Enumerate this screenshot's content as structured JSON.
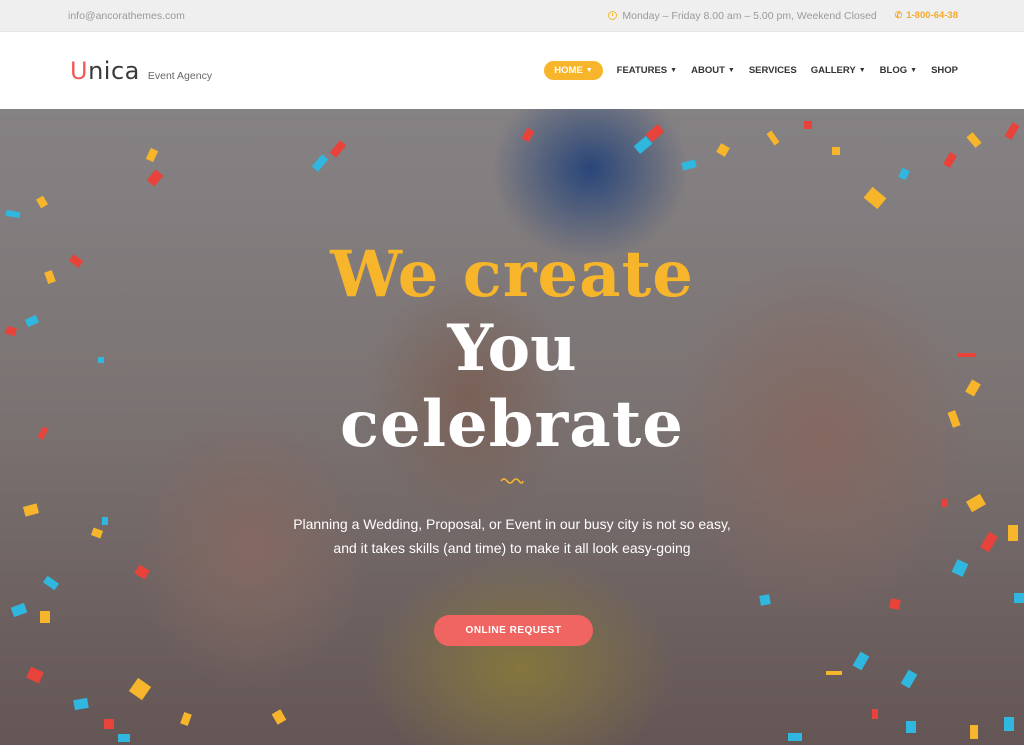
{
  "topbar": {
    "email": "info@ancorathemes.com",
    "hours": "Monday – Friday 8.00 am – 5.00 pm, Weekend Closed",
    "phone": "1-800-64-38"
  },
  "header": {
    "logo_text": "nica",
    "logo_letter": "U",
    "logo_sub": "Event Agency",
    "nav": [
      {
        "label": "HOME",
        "dropdown": true
      },
      {
        "label": "FEATURES",
        "dropdown": true
      },
      {
        "label": "ABOUT",
        "dropdown": true
      },
      {
        "label": "SERVICES",
        "dropdown": false
      },
      {
        "label": "GALLERY",
        "dropdown": true
      },
      {
        "label": "BLOG",
        "dropdown": true
      },
      {
        "label": "SHOP",
        "dropdown": false
      }
    ]
  },
  "hero": {
    "line1": "We create",
    "line2": "You",
    "line3": "celebrate",
    "desc_line1": "Planning a Wedding, Proposal, or Event in our busy city is not so easy,",
    "desc_line2": "and it takes skills (and time) to make it all look easy-going",
    "cta": "ONLINE REQUEST"
  },
  "colors": {
    "accent": "#f7b52b",
    "cta": "#f06461",
    "logo": "#f05a57"
  },
  "icons": {
    "hours_icon": "clock-icon",
    "phone_icon": "phone-icon",
    "nav_dropdown_icon": "chevron-down-icon"
  }
}
